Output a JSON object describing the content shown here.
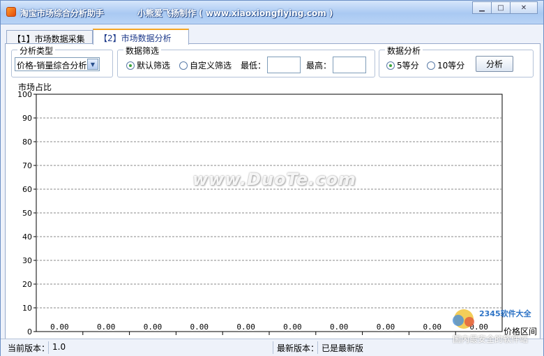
{
  "window": {
    "title": "淘宝市场综合分析助手",
    "subtitle": "小熊爱飞扬制作 ( www.xiaoxiongflying.com )",
    "controls": [
      "minimize",
      "maximize",
      "close"
    ]
  },
  "tabs": [
    {
      "label": "【1】市场数据采集",
      "active": false
    },
    {
      "label": "【2】市场数据分析",
      "active": true
    }
  ],
  "analysis_type": {
    "title": "分析类型",
    "selected": "价格-销量综合分析"
  },
  "data_filter": {
    "title": "数据筛选",
    "default_label": "默认筛选",
    "custom_label": "自定义筛选",
    "min_label": "最低：",
    "max_label": "最高：",
    "min_value": "",
    "max_value": "",
    "selected": "default"
  },
  "data_analysis": {
    "title": "数据分析",
    "option5_label": "5等分",
    "option10_label": "10等分",
    "selected": "5",
    "analyze_button": "分析"
  },
  "chart_data": {
    "type": "bar",
    "ylabel": "市场占比",
    "xlabel": "价格区间",
    "ylim": [
      0,
      100
    ],
    "yticks": [
      "0",
      "10",
      "20",
      "30",
      "40",
      "50",
      "60",
      "70",
      "80",
      "90",
      "100"
    ],
    "categories": [
      "",
      "",
      "",
      "",
      "",
      "",
      "",
      "",
      "",
      ""
    ],
    "values": [
      0,
      0,
      0,
      0,
      0,
      0,
      0,
      0,
      0,
      0
    ],
    "value_labels": [
      "0.00",
      "0.00",
      "0.00",
      "0.00",
      "0.00",
      "0.00",
      "0.00",
      "0.00",
      "0.00",
      "0.00"
    ],
    "grid": true,
    "watermark": "www.DuoTe.com"
  },
  "status": {
    "current_version_label": "当前版本：",
    "current_version": "1.0",
    "latest_version_label": "最新版本：",
    "latest_version": "已是最新版"
  },
  "corner_logo": {
    "brand": "2345软件大全",
    "slogan": "国内最安全的软件站"
  }
}
